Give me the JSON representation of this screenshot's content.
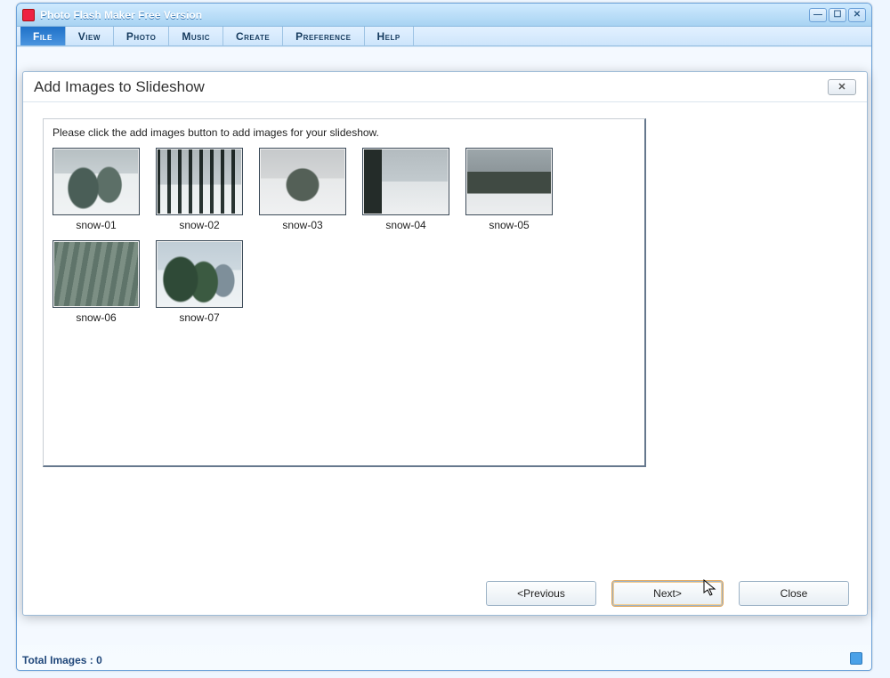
{
  "app": {
    "title": "Photo Flash Maker Free Version"
  },
  "menus": {
    "file": "File",
    "view": "View",
    "photo": "Photo",
    "music": "Music",
    "create": "Create",
    "preference": "Preference",
    "help": "Help"
  },
  "dialog": {
    "title": "Add Images to Slideshow",
    "instruction": "Please click the add images button to add  images for your slideshow.",
    "buttons": {
      "previous": "<Previous",
      "next": "Next>",
      "close": "Close"
    }
  },
  "thumbs": [
    {
      "label": "snow-01",
      "class": "snow-01"
    },
    {
      "label": "snow-02",
      "class": "snow-02"
    },
    {
      "label": "snow-03",
      "class": "snow-03"
    },
    {
      "label": "snow-04",
      "class": "snow-04"
    },
    {
      "label": "snow-05",
      "class": "snow-05"
    },
    {
      "label": "snow-06",
      "class": "snow-06"
    },
    {
      "label": "snow-07",
      "class": "snow-07"
    }
  ],
  "status": {
    "total_images": "Total Images : 0"
  }
}
